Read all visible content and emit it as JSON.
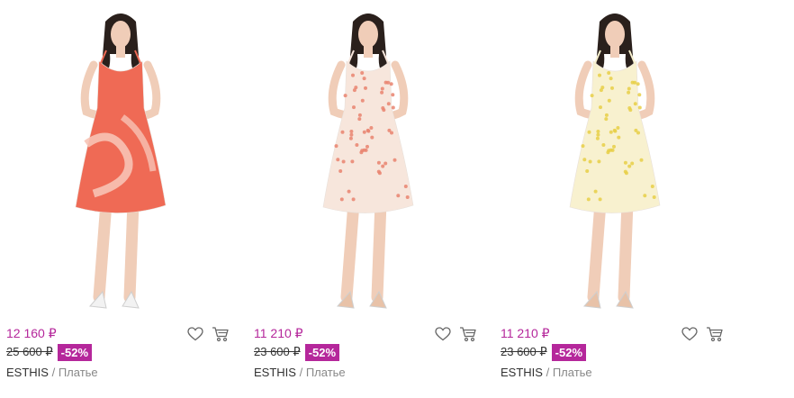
{
  "theme": {
    "price_color": "#b5279b",
    "badge_color": "#b5279b"
  },
  "products": [
    {
      "price": "12 160 ₽",
      "old_price": "25 600 ₽",
      "discount": "-52%",
      "brand": "ESTHIS",
      "separator": "/",
      "category": "Платье",
      "dress_color": "#ef6a55",
      "dress_accent": "#f7c3b5",
      "dress_pattern": "abstract-swirl",
      "shoe_color": "#f2f2f2"
    },
    {
      "price": "11 210 ₽",
      "old_price": "23 600 ₽",
      "discount": "-52%",
      "brand": "ESTHIS",
      "separator": "/",
      "category": "Платье",
      "dress_color": "#f7e6dc",
      "dress_accent": "#e9836f",
      "dress_pattern": "small-floral",
      "shoe_color": "#e8c2a8"
    },
    {
      "price": "11 210 ₽",
      "old_price": "23 600 ₽",
      "discount": "-52%",
      "brand": "ESTHIS",
      "separator": "/",
      "category": "Платье",
      "dress_color": "#f8f1cf",
      "dress_accent": "#e7cf47",
      "dress_pattern": "small-floral",
      "shoe_color": "#e8c2a8"
    }
  ],
  "icons": {
    "favorite": "heart-icon",
    "cart": "cart-icon"
  }
}
